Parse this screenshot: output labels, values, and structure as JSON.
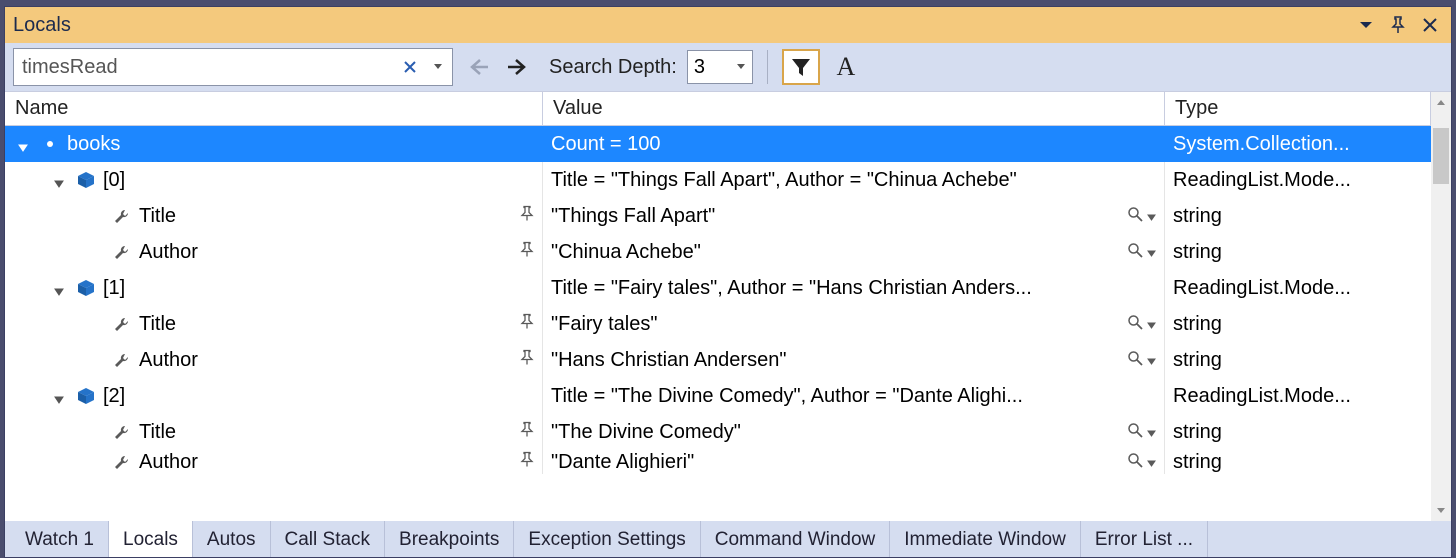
{
  "titlebar": {
    "title": "Locals"
  },
  "toolbar": {
    "search_value": "timesRead",
    "search_depth_label": "Search Depth:",
    "search_depth_value": "3"
  },
  "columns": {
    "name": "Name",
    "value": "Value",
    "type": "Type"
  },
  "tree": [
    {
      "indent": 0,
      "expander": "down",
      "icon": "cube-open",
      "name": "books",
      "value": "Count = 100",
      "type": "System.Collection...",
      "selected": true
    },
    {
      "indent": 1,
      "expander": "down",
      "icon": "cube",
      "name": "[0]",
      "value": "Title = \"Things Fall Apart\", Author = \"Chinua Achebe\"",
      "type": "ReadingList.Mode..."
    },
    {
      "indent": 2,
      "expander": "none",
      "icon": "wrench",
      "name": "Title",
      "pin": true,
      "value": "\"Things Fall Apart\"",
      "type": "string",
      "visualizer": true
    },
    {
      "indent": 2,
      "expander": "none",
      "icon": "wrench",
      "name": "Author",
      "pin": true,
      "value": "\"Chinua Achebe\"",
      "type": "string",
      "visualizer": true
    },
    {
      "indent": 1,
      "expander": "down",
      "icon": "cube",
      "name": "[1]",
      "value": "Title = \"Fairy tales\", Author = \"Hans Christian Anders...",
      "type": "ReadingList.Mode..."
    },
    {
      "indent": 2,
      "expander": "none",
      "icon": "wrench",
      "name": "Title",
      "pin": true,
      "value": "\"Fairy tales\"",
      "type": "string",
      "visualizer": true
    },
    {
      "indent": 2,
      "expander": "none",
      "icon": "wrench",
      "name": "Author",
      "pin": true,
      "value": "\"Hans Christian Andersen\"",
      "type": "string",
      "visualizer": true
    },
    {
      "indent": 1,
      "expander": "down",
      "icon": "cube",
      "name": "[2]",
      "value": "Title = \"The Divine Comedy\", Author = \"Dante Alighi...",
      "type": "ReadingList.Mode..."
    },
    {
      "indent": 2,
      "expander": "none",
      "icon": "wrench",
      "name": "Title",
      "pin": true,
      "value": "\"The Divine Comedy\"",
      "type": "string",
      "visualizer": true
    },
    {
      "indent": 2,
      "expander": "none",
      "icon": "wrench",
      "name": "Author",
      "pin": true,
      "value": "\"Dante Alighieri\"",
      "type": "string",
      "visualizer": true,
      "cut": true
    }
  ],
  "tabs": [
    {
      "label": "Watch 1",
      "active": false
    },
    {
      "label": "Locals",
      "active": true
    },
    {
      "label": "Autos",
      "active": false
    },
    {
      "label": "Call Stack",
      "active": false
    },
    {
      "label": "Breakpoints",
      "active": false
    },
    {
      "label": "Exception Settings",
      "active": false
    },
    {
      "label": "Command Window",
      "active": false
    },
    {
      "label": "Immediate Window",
      "active": false
    },
    {
      "label": "Error List ...",
      "active": false
    }
  ]
}
